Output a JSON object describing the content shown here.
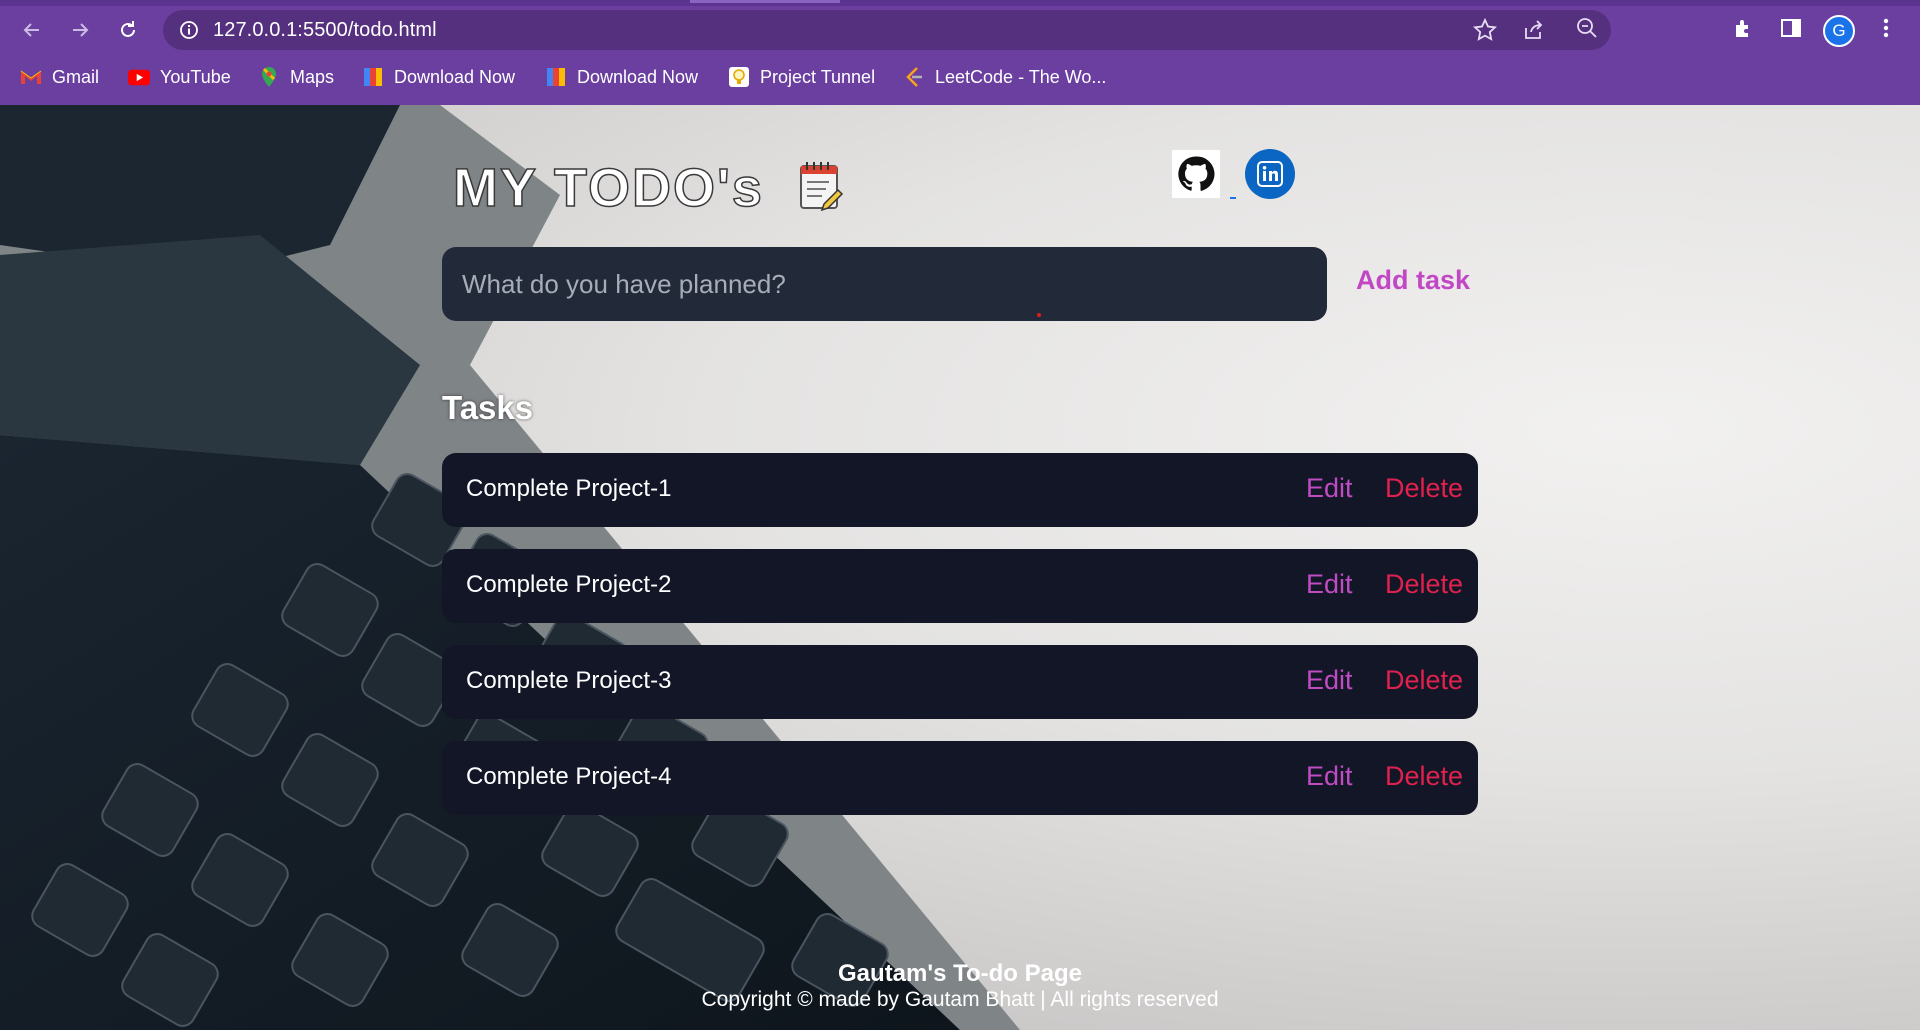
{
  "browser": {
    "url": "127.0.0.1:5500/todo.html",
    "profile_initial": "G",
    "accent": "#6a3fa0",
    "bookmarks": [
      {
        "label": "Gmail",
        "icon": "gmail-icon"
      },
      {
        "label": "YouTube",
        "icon": "youtube-icon"
      },
      {
        "label": "Maps",
        "icon": "maps-icon"
      },
      {
        "label": "Download Now",
        "icon": "download-icon"
      },
      {
        "label": "Download Now",
        "icon": "download-icon"
      },
      {
        "label": "Project Tunnel",
        "icon": "bulb-icon"
      },
      {
        "label": "LeetCode - The Wo...",
        "icon": "leetcode-icon"
      }
    ]
  },
  "header": {
    "title": "MY TODO's",
    "title_icon": "notepad-icon",
    "social": [
      "github-icon",
      "linkedin-icon"
    ]
  },
  "form": {
    "placeholder": "What do you have planned?",
    "add_label": "Add task"
  },
  "tasks_heading": "Tasks",
  "tasks": [
    {
      "text": "Complete Project-1",
      "edit": "Edit",
      "delete": "Delete"
    },
    {
      "text": "Complete Project-2",
      "edit": "Edit",
      "delete": "Delete"
    },
    {
      "text": "Complete Project-3",
      "edit": "Edit",
      "delete": "Delete"
    },
    {
      "text": "Complete Project-4",
      "edit": "Edit",
      "delete": "Delete"
    }
  ],
  "footer": {
    "title": "Gautam's To-do Page",
    "copyright": "Copyright © made by Gautam Bhatt | All rights reserved"
  },
  "colors": {
    "input_bg": "#222a3a",
    "task_bg": "#121626",
    "add_task": "#c147c4",
    "edit": "#bf4cc2",
    "delete": "#e0204d"
  }
}
